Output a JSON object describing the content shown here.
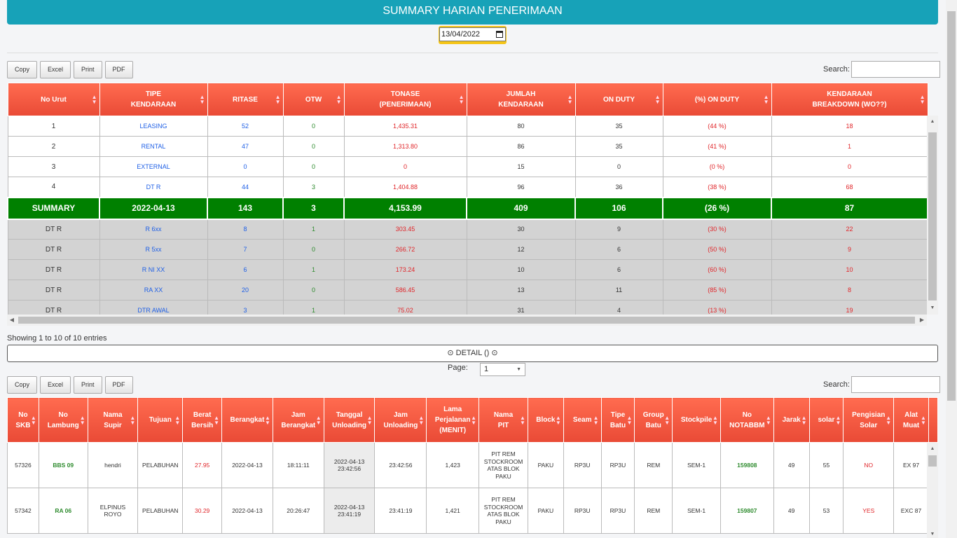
{
  "title": "SUMMARY HARIAN PENERIMAAN",
  "date_value": "13/04/2022",
  "toolbar": {
    "copy": "Copy",
    "excel": "Excel",
    "print": "Print",
    "pdf": "PDF",
    "search_label": "Search:"
  },
  "summary_table": {
    "headers": [
      "No Urut",
      "TIPE\nKENDARAAN",
      "RITASE",
      "OTW",
      "TONASE\n(PENERIMAAN)",
      "JUMLAH\nKENDARAAN",
      "ON DUTY",
      "(%) ON DUTY",
      "KENDARAAN\nBREAKDOWN (WO??)"
    ],
    "rows": [
      [
        "1",
        "LEASING",
        "52",
        "0",
        "1,435.31",
        "80",
        "35",
        "(44 %)",
        "18"
      ],
      [
        "2",
        "RENTAL",
        "47",
        "0",
        "1,313.80",
        "86",
        "35",
        "(41 %)",
        "1"
      ],
      [
        "3",
        "EXTERNAL",
        "0",
        "0",
        "0",
        "15",
        "0",
        "(0 %)",
        "0"
      ],
      [
        "4",
        "DT R",
        "44",
        "3",
        "1,404.88",
        "96",
        "36",
        "(38 %)",
        "68"
      ]
    ],
    "summary": [
      "SUMMARY",
      "2022-04-13",
      "143",
      "3",
      "4,153.99",
      "409",
      "106",
      "(26 %)",
      "87"
    ],
    "detail_rows": [
      [
        "DT R",
        "R 6xx",
        "8",
        "1",
        "303.45",
        "30",
        "9",
        "(30 %)",
        "22"
      ],
      [
        "DT R",
        "R 5xx",
        "7",
        "0",
        "266.72",
        "12",
        "6",
        "(50 %)",
        "9"
      ],
      [
        "DT R",
        "R NI XX",
        "6",
        "1",
        "173.24",
        "10",
        "6",
        "(60 %)",
        "10"
      ],
      [
        "DT R",
        "RA XX",
        "20",
        "0",
        "586.45",
        "13",
        "11",
        "(85 %)",
        "8"
      ],
      [
        "DT R",
        "DTR AWAL",
        "3",
        "1",
        "75.02",
        "31",
        "4",
        "(13 %)",
        "19"
      ]
    ]
  },
  "info_text": "Showing 1 to 10 of 10 entries",
  "detail_label": "DETAIL ()",
  "page_label": "Page:",
  "page_value": "1",
  "detail_table": {
    "headers": [
      "No\nSKB",
      "No\nLambung",
      "Nama\nSupir",
      "Tujuan",
      "Berat\nBersih",
      "Berangkat",
      "Jam\nBerangkat",
      "Tanggal\nUnloading",
      "Jam\nUnloading",
      "Lama\nPerjalanan\n(MENIT)",
      "Nama\nPIT",
      "Block",
      "Seam",
      "Tipe\nBatu",
      "Group\nBatu",
      "Stockpile",
      "No\nNOTABBM",
      "Jarak",
      "solar",
      "Pengisian\nSolar",
      "Alat\nMuat"
    ],
    "rows": [
      [
        "57326",
        "BBS 09",
        "hendri",
        "PELABUHAN",
        "27.95",
        "2022-04-13",
        "18:11:11",
        "2022-04-13\n23:42:56",
        "23:42:56",
        "1,423",
        "PIT REM\nSTOCKROOM\nATAS BLOK\nPAKU",
        "PAKU",
        "RP3U",
        "RP3U",
        "REM",
        "SEM-1",
        "159808",
        "49",
        "55",
        "NO",
        "EX 97"
      ],
      [
        "57342",
        "RA 06",
        "ELPINUS\nROYO",
        "PELABUHAN",
        "30.29",
        "2022-04-13",
        "20:26:47",
        "2022-04-13\n23:41:19",
        "23:41:19",
        "1,421",
        "PIT REM\nSTOCKROOM\nATAS BLOK\nPAKU",
        "PAKU",
        "RP3U",
        "RP3U",
        "REM",
        "SEM-1",
        "159807",
        "49",
        "53",
        "YES",
        "EXC 87"
      ]
    ]
  },
  "colors": {
    "header": "#17a2b8",
    "th": "#e94a36",
    "summary": "#008000",
    "date_border": "#f5c518"
  }
}
